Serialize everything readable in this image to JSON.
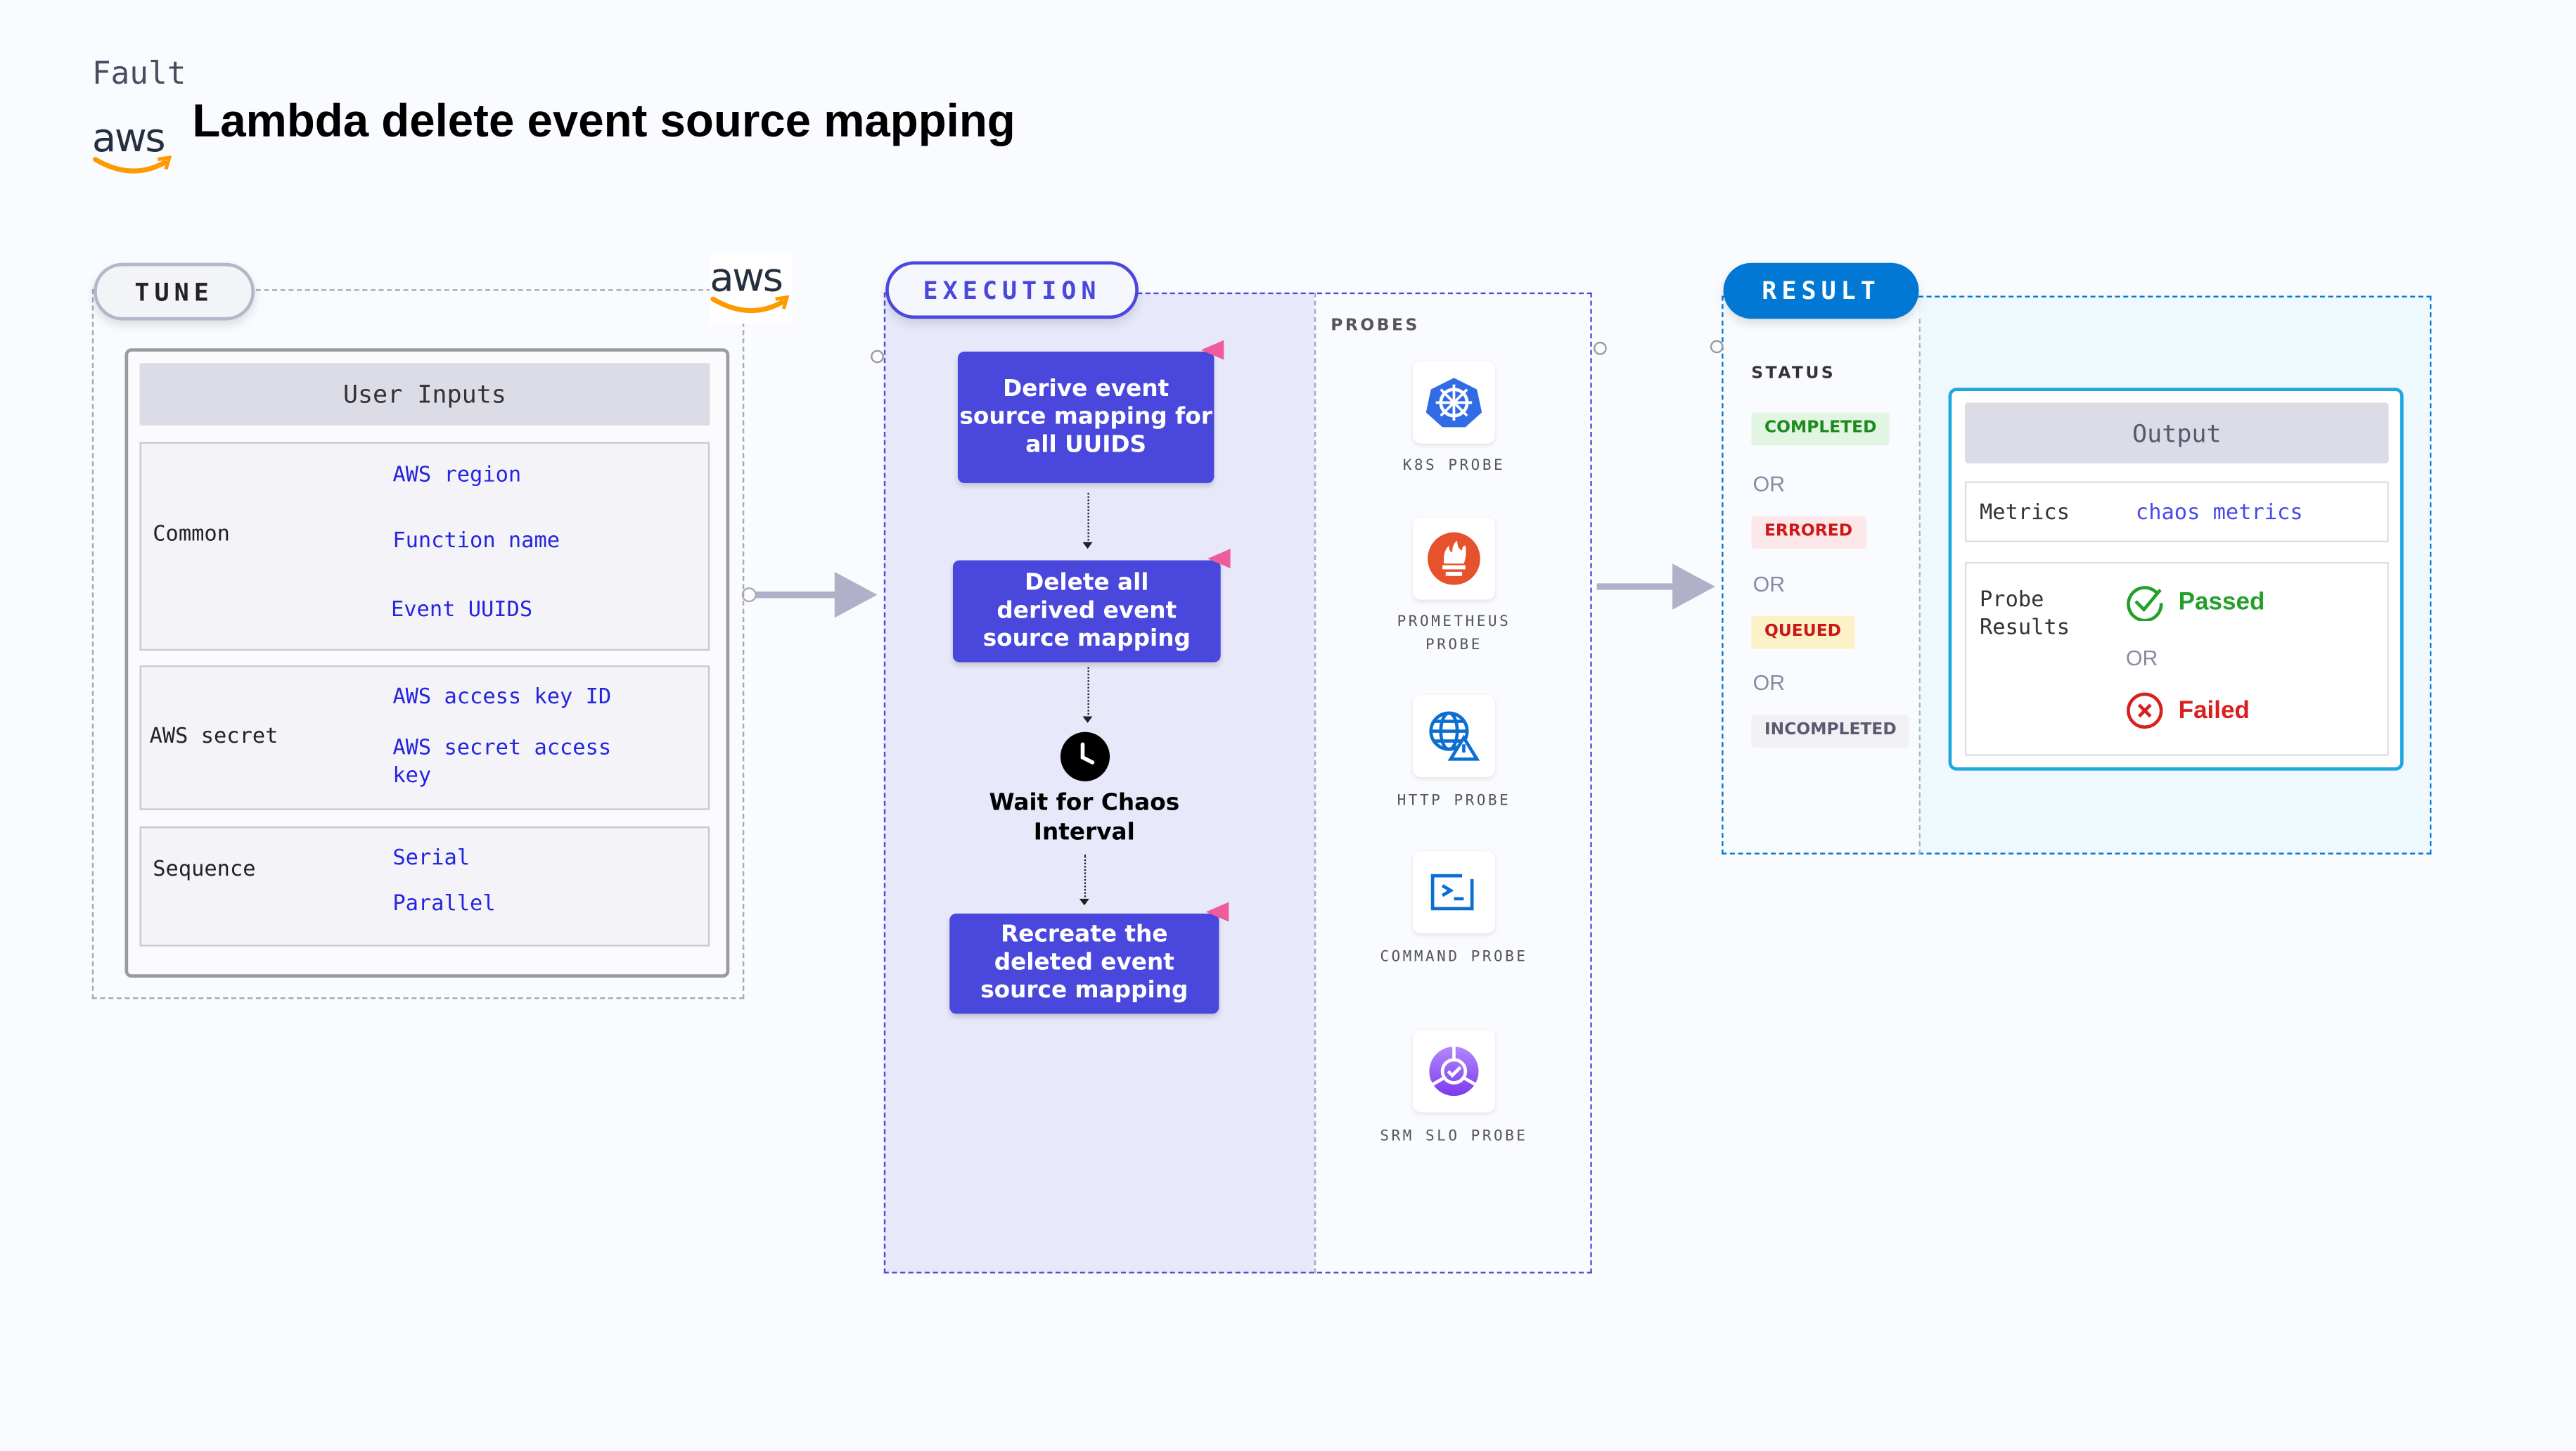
{
  "header": {
    "kicker": "Fault",
    "title": "Lambda delete event source mapping",
    "logo": "aws"
  },
  "tune": {
    "label": "TUNE",
    "logo": "aws",
    "card_title": "User Inputs",
    "rows": [
      {
        "label": "Common",
        "values": [
          "AWS region",
          "Function name",
          "Event UUIDS"
        ]
      },
      {
        "label": "AWS secret",
        "values": [
          "AWS access key ID",
          "AWS secret access key"
        ]
      },
      {
        "label": "Sequence",
        "values": [
          "Serial",
          "Parallel"
        ]
      }
    ]
  },
  "execution": {
    "label": "EXECUTION",
    "steps": [
      "Derive event source mapping for all UUIDS",
      "Delete all derived event source mapping",
      "Recreate the deleted event source mapping"
    ],
    "wait": "Wait for Chaos Interval",
    "probes_title": "PROBES",
    "probes": [
      {
        "label": "K8S PROBE",
        "icon": "kubernetes-icon"
      },
      {
        "label": "PROMETHEUS PROBE",
        "icon": "prometheus-icon"
      },
      {
        "label": "HTTP PROBE",
        "icon": "http-globe-icon"
      },
      {
        "label": "COMMAND PROBE",
        "icon": "terminal-icon"
      },
      {
        "label": "SRM SLO PROBE",
        "icon": "srm-slo-icon"
      }
    ]
  },
  "result": {
    "label": "RESULT",
    "status_title": "STATUS",
    "statuses": [
      {
        "label": "COMPLETED",
        "color": "#1e8a1e",
        "bg": "#e2f5e2"
      },
      {
        "label": "ERRORED",
        "color": "#d01818",
        "bg": "#fce8e8"
      },
      {
        "label": "QUEUED",
        "color": "#c81818",
        "bg": "#fdf1c8"
      },
      {
        "label": "INCOMPLETED",
        "color": "#5a5a6e",
        "bg": "#f0f0f5"
      }
    ],
    "or": "OR",
    "output": {
      "title": "Output",
      "metrics_label": "Metrics",
      "metrics_value": "chaos metrics",
      "probe_label": "Probe Results",
      "passed": "Passed",
      "failed": "Failed",
      "or": "OR"
    }
  },
  "colors": {
    "execution": "#4a48dc",
    "result": "#0078d4",
    "passed": "#22a02a",
    "failed": "#d8201e"
  }
}
